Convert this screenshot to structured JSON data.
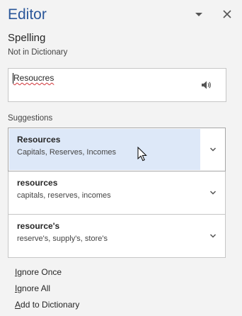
{
  "pane": {
    "title": "Editor"
  },
  "spelling": {
    "title": "Spelling",
    "subtitle": "Not in Dictionary",
    "word": "Resoucres"
  },
  "suggestions": {
    "label": "Suggestions",
    "items": [
      {
        "word": "Resources",
        "synonyms": "Capitals, Reserves, Incomes",
        "selected": true
      },
      {
        "word": "resources",
        "synonyms": "capitals, reserves, incomes",
        "selected": false
      },
      {
        "word": "resource's",
        "synonyms": "reserve's, supply's, store's",
        "selected": false
      }
    ]
  },
  "actions": {
    "ignore_once": {
      "key": "I",
      "rest": "gnore Once"
    },
    "ignore_all": {
      "key": "I",
      "rest": "gnore All"
    },
    "add_to_dictionary": {
      "key": "A",
      "rest": "dd to Dictionary"
    }
  },
  "colors": {
    "title": "#2b579a",
    "selected_bg": "#dde8f8",
    "misspelling_underline": "#d13438"
  },
  "icons": {
    "dropdown": "chevron-down-icon",
    "close": "close-icon",
    "speaker": "speaker-icon",
    "expand": "chevron-down-icon",
    "cursor": "mouse-pointer-icon"
  }
}
